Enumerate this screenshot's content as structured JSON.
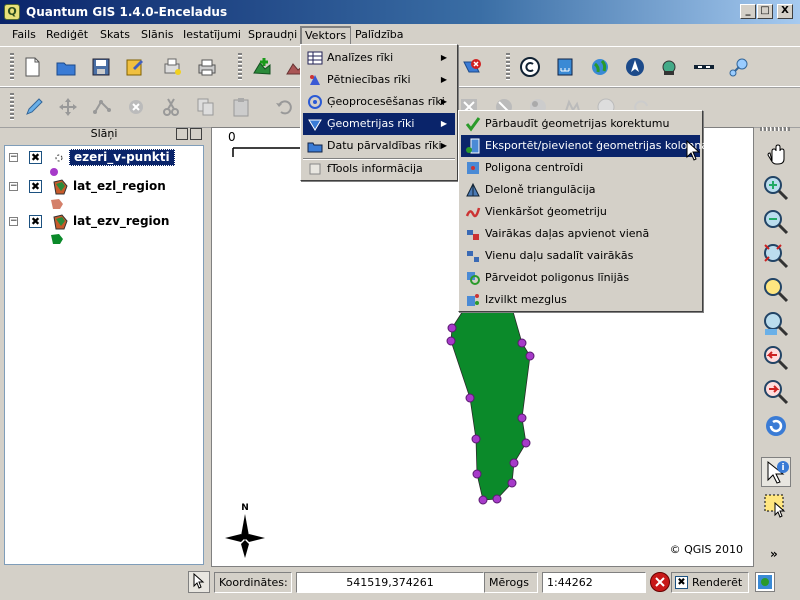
{
  "window": {
    "title": "Quantum GIS 1.4.0-Enceladus",
    "app_icon_glyph": "Q",
    "min_glyph": "_",
    "max_glyph": "□",
    "close_glyph": "X"
  },
  "menubar": {
    "items": [
      "Fails",
      "Rediģēt",
      "Skats",
      "Slānis",
      "Iestatījumi",
      "Spraudņi",
      "Vektors",
      "Palīdzība"
    ],
    "active": "Vektors"
  },
  "layers_panel": {
    "title": "Slāņi",
    "expand_glyph": "−",
    "check_glyph": "✖",
    "layers": [
      {
        "name": "ezeri_v-punkti",
        "selected": true
      },
      {
        "name": "lat_ezl_region",
        "selected": false
      },
      {
        "name": "lat_ezv_region",
        "selected": false
      }
    ]
  },
  "map": {
    "scale_label": "0",
    "north_label": "N",
    "copyright": "© QGIS 2010",
    "polygon_color": "#0b8a2a",
    "vertex_color": "#a63ac9"
  },
  "vector_menu": {
    "items": [
      {
        "label": "Analīzes rīki",
        "icon": "table-icon",
        "submenu": true
      },
      {
        "label": "Pētniecības rīki",
        "icon": "research-icon",
        "submenu": true
      },
      {
        "label": "Ģeoprocesēšanas rīki",
        "icon": "geoprocessing-icon",
        "submenu": true
      },
      {
        "label": "Ģeometrijas rīki",
        "icon": "geometry-icon",
        "submenu": true,
        "highlighted": true
      },
      {
        "label": "Datu pārvaldības rīki",
        "icon": "data-management-icon",
        "submenu": true
      },
      {
        "label": "fTools informācija",
        "icon": "info-icon",
        "submenu": false
      }
    ],
    "submenu_arrow": "▶"
  },
  "geometry_submenu": {
    "items": [
      {
        "label": "Pārbaudīt ģeometrijas korektumu",
        "icon": "check-geometry-icon"
      },
      {
        "label": "Eksportēt/pievienot ģeometrijas kolonnas",
        "icon": "export-columns-icon",
        "highlighted": true
      },
      {
        "label": "Poligona centroīdi",
        "icon": "centroid-icon"
      },
      {
        "label": "Deloně triangulācija",
        "icon": "triangulation-icon"
      },
      {
        "label": "Vienkāršot ģeometriju",
        "icon": "simplify-icon"
      },
      {
        "label": "Vairākas daļas apvienot vienā",
        "icon": "merge-parts-icon"
      },
      {
        "label": "Vienu daļu sadalīt vairākās",
        "icon": "split-parts-icon"
      },
      {
        "label": "Pārveidot poligonus līnijās",
        "icon": "polygon-to-line-icon"
      },
      {
        "label": "Izvilkt mezglus",
        "icon": "extract-nodes-icon"
      }
    ]
  },
  "statusbar": {
    "coords_label": "Koordinātes:",
    "coords_value": "541519,374261",
    "scale_label": "Mērogs",
    "scale_value": "1:44262",
    "render_label": "Renderēt",
    "render_check": "✖"
  },
  "colors": {
    "selection": "#0a246a",
    "chrome": "#d4d0c8"
  }
}
